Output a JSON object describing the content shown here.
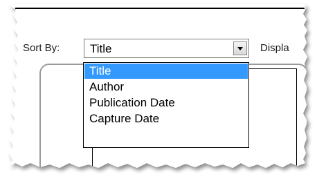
{
  "sort": {
    "label": "Sort By:",
    "selected_value": "Title",
    "options": [
      "Title",
      "Author",
      "Publication Date",
      "Capture Date"
    ],
    "highlighted_index": 0
  },
  "display": {
    "label": "Displa"
  },
  "colors": {
    "highlight": "#3399ff",
    "highlight_text": "#ffffff",
    "text": "#000000"
  },
  "icons": {
    "dropdown_arrow": "chevron-down-icon"
  }
}
